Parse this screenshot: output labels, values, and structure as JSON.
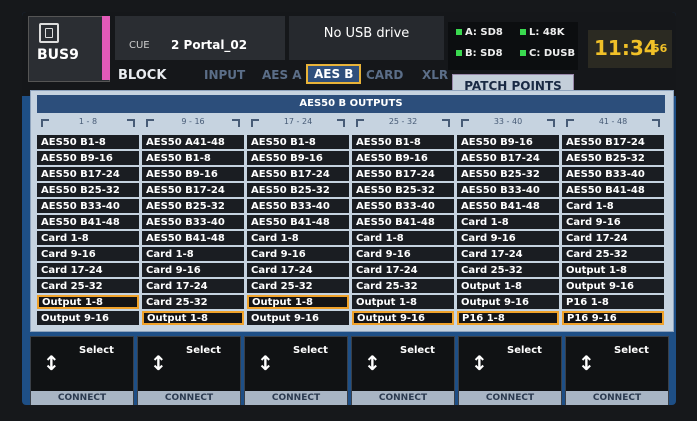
{
  "header": {
    "bus_name": "BUS9",
    "cue_label": "CUE",
    "cue_value": "2 Portal_02",
    "usb_status": "No USB drive",
    "sync": {
      "a": "A: SD8",
      "b": "B: SD8",
      "l": "L: 48K",
      "c": "C: DUSB"
    },
    "clock_hm": "11:34",
    "clock_sec": "56"
  },
  "tabs": {
    "block": "BLOCK",
    "input": "INPUT",
    "aes_a": "AES A",
    "aes_b": "AES B",
    "card": "CARD",
    "xlr": "XLR",
    "patch_points": "PATCH POINTS"
  },
  "panel": {
    "title": "AES50 B OUTPUTS"
  },
  "columns": [
    {
      "range": "1 - 8",
      "items": [
        "AES50 B1-8",
        "AES50 B9-16",
        "AES50 B17-24",
        "AES50 B25-32",
        "AES50 B33-40",
        "AES50 B41-48",
        "Card 1-8",
        "Card 9-16",
        "Card 17-24",
        "Card 25-32",
        "Output 1-8",
        "Output 9-16"
      ],
      "selected": 10
    },
    {
      "range": "9 - 16",
      "items": [
        "AES50 A41-48",
        "AES50 B1-8",
        "AES50 B9-16",
        "AES50 B17-24",
        "AES50 B25-32",
        "AES50 B33-40",
        "AES50 B41-48",
        "Card 1-8",
        "Card 9-16",
        "Card 17-24",
        "Card 25-32",
        "Output 1-8"
      ],
      "selected": 11
    },
    {
      "range": "17 - 24",
      "items": [
        "AES50 B1-8",
        "AES50 B9-16",
        "AES50 B17-24",
        "AES50 B25-32",
        "AES50 B33-40",
        "AES50 B41-48",
        "Card 1-8",
        "Card 9-16",
        "Card 17-24",
        "Card 25-32",
        "Output 1-8",
        "Output 9-16"
      ],
      "selected": 10
    },
    {
      "range": "25 - 32",
      "items": [
        "AES50 B1-8",
        "AES50 B9-16",
        "AES50 B17-24",
        "AES50 B25-32",
        "AES50 B33-40",
        "AES50 B41-48",
        "Card 1-8",
        "Card 9-16",
        "Card 17-24",
        "Card 25-32",
        "Output 1-8",
        "Output 9-16"
      ],
      "selected": 11
    },
    {
      "range": "33 - 40",
      "items": [
        "AES50 B9-16",
        "AES50 B17-24",
        "AES50 B25-32",
        "AES50 B33-40",
        "AES50 B41-48",
        "Card 1-8",
        "Card 9-16",
        "Card 17-24",
        "Card 25-32",
        "Output 1-8",
        "Output 9-16",
        "P16 1-8"
      ],
      "selected": 11
    },
    {
      "range": "41 - 48",
      "items": [
        "AES50 B17-24",
        "AES50 B25-32",
        "AES50 B33-40",
        "AES50 B41-48",
        "Card 1-8",
        "Card 9-16",
        "Card 17-24",
        "Card 25-32",
        "Output 1-8",
        "Output 9-16",
        "P16 1-8",
        "P16 9-16"
      ],
      "selected": 11
    }
  ],
  "controls": {
    "select_label": "Select",
    "connect_label": "CONNECT"
  },
  "colors": {
    "accent": "#f0a22a",
    "screen_bg": "#1e4f86",
    "clock": "#f0c028",
    "sync_led": "#3ad94f",
    "bus_color": "#e25ab8"
  }
}
